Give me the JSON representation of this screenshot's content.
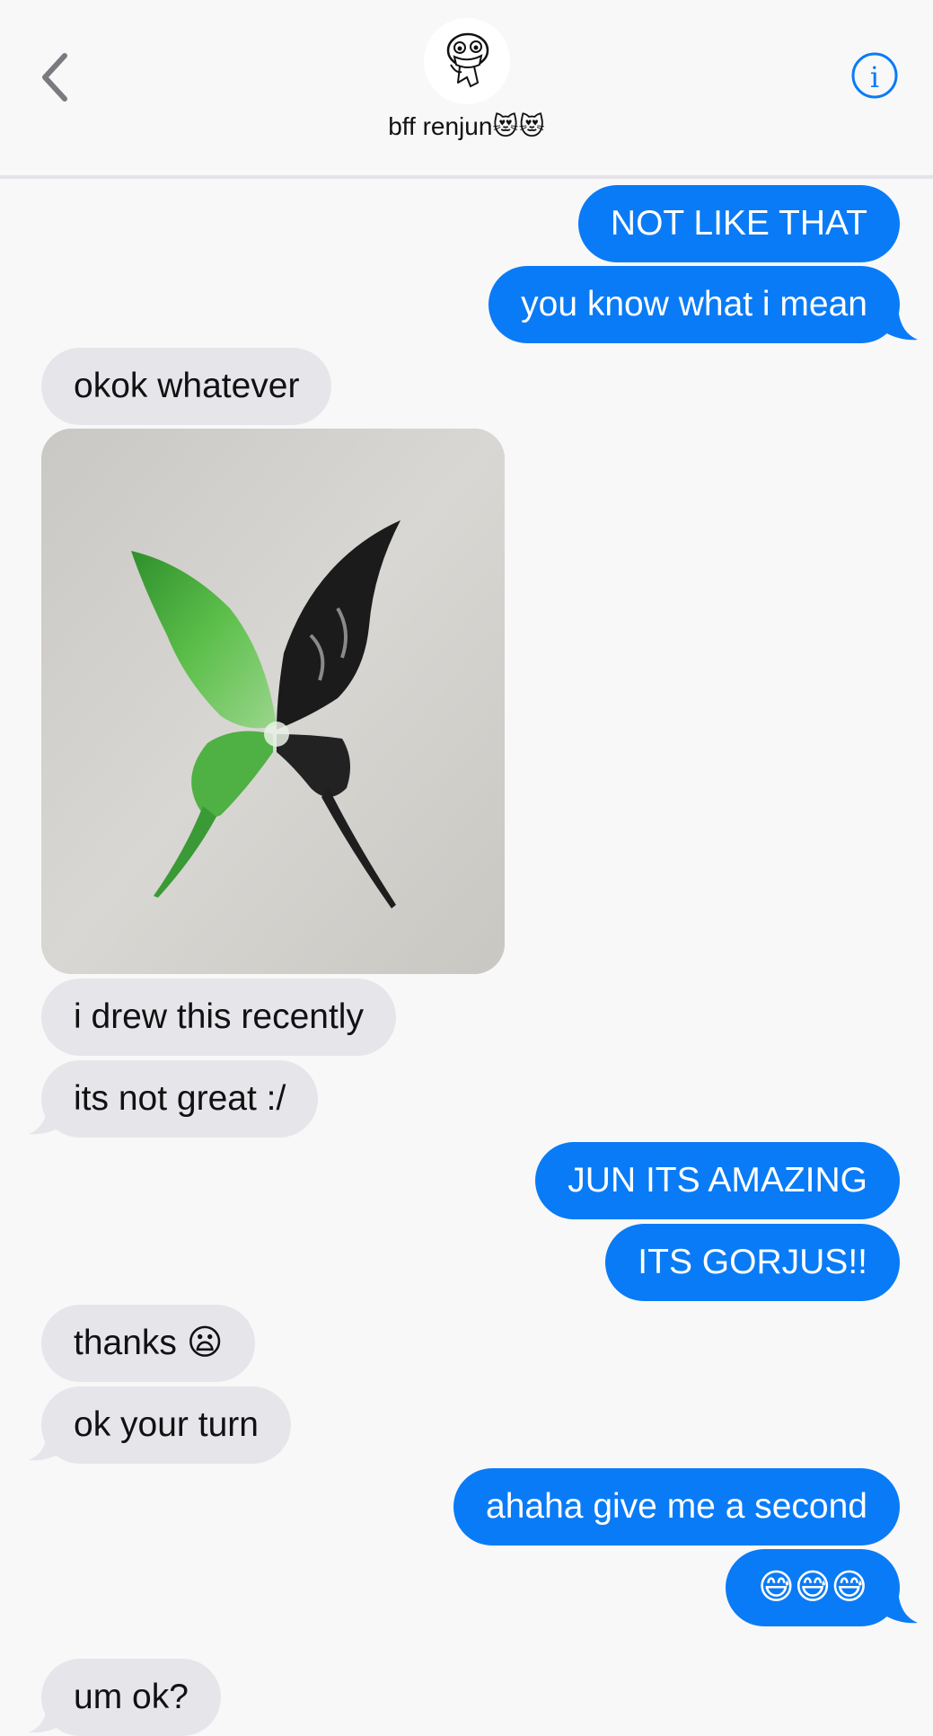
{
  "header": {
    "contact_name": "bff renjun😻😻",
    "back_icon": "chevron-left-icon",
    "info_icon": "info-icon",
    "accent": "#0a7bf6"
  },
  "messages": [
    {
      "side": "sent",
      "text": "NOT LIKE THAT"
    },
    {
      "side": "sent",
      "text": "you know what i mean"
    },
    {
      "side": "received",
      "text": "okok whatever"
    },
    {
      "side": "received",
      "type": "image",
      "description": "butterfly painting"
    },
    {
      "side": "received",
      "text": "i drew this recently"
    },
    {
      "side": "received",
      "text": "its not great :/"
    },
    {
      "side": "sent",
      "text": "JUN ITS AMAZING"
    },
    {
      "side": "sent",
      "text": "ITS GORJUS!!"
    },
    {
      "side": "received",
      "text": "thanks 😦"
    },
    {
      "side": "received",
      "text": "ok your turn"
    },
    {
      "side": "sent",
      "text": "ahaha give me a second"
    },
    {
      "side": "sent",
      "text": "😅😅😅"
    },
    {
      "side": "received",
      "text": "um ok?"
    }
  ],
  "colors": {
    "sent_bubble": "#0a7bf6",
    "received_bubble": "#e6e5ea",
    "background": "#f8f8f8"
  }
}
